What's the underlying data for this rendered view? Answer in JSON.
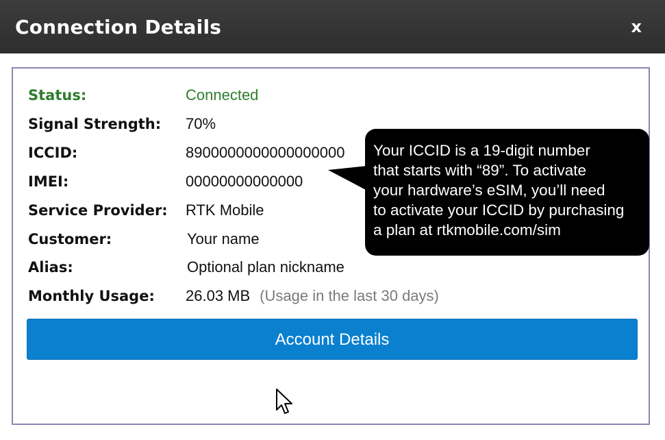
{
  "dialog": {
    "title": "Connection Details",
    "close_label": "x"
  },
  "details": [
    {
      "label": "Status:",
      "value": "Connected"
    },
    {
      "label": "Signal Strength:",
      "value": "70%"
    },
    {
      "label": "ICCID:",
      "value": "8900000000000000000"
    },
    {
      "label": "IMEI:",
      "value": "00000000000000"
    },
    {
      "label": "Service Provider:",
      "value": "RTK Mobile"
    },
    {
      "label": "Customer:",
      "value": "Your name"
    },
    {
      "label": "Alias:",
      "value": "Optional plan nickname"
    },
    {
      "label": "Monthly Usage:",
      "value": "26.03 MB",
      "note": "(Usage in the last 30 days)"
    }
  ],
  "account_button_label": "Account Details",
  "callout": {
    "lines": [
      "Your ICCID is a 19-digit number",
      "that starts with “89”. To activate",
      "your hardware’s eSIM, you’ll need",
      "to activate your ICCID by purchasing",
      "a plan at rtkmobile.com/sim"
    ]
  },
  "colors": {
    "titlebar": "#333333",
    "status_green": "#2e7d2e",
    "button_blue": "#0b80cf",
    "panel_border": "#8a84b4",
    "callout_bg": "#000000"
  },
  "icons": {
    "close": "close-icon",
    "cursor": "mouse-pointer-icon"
  }
}
